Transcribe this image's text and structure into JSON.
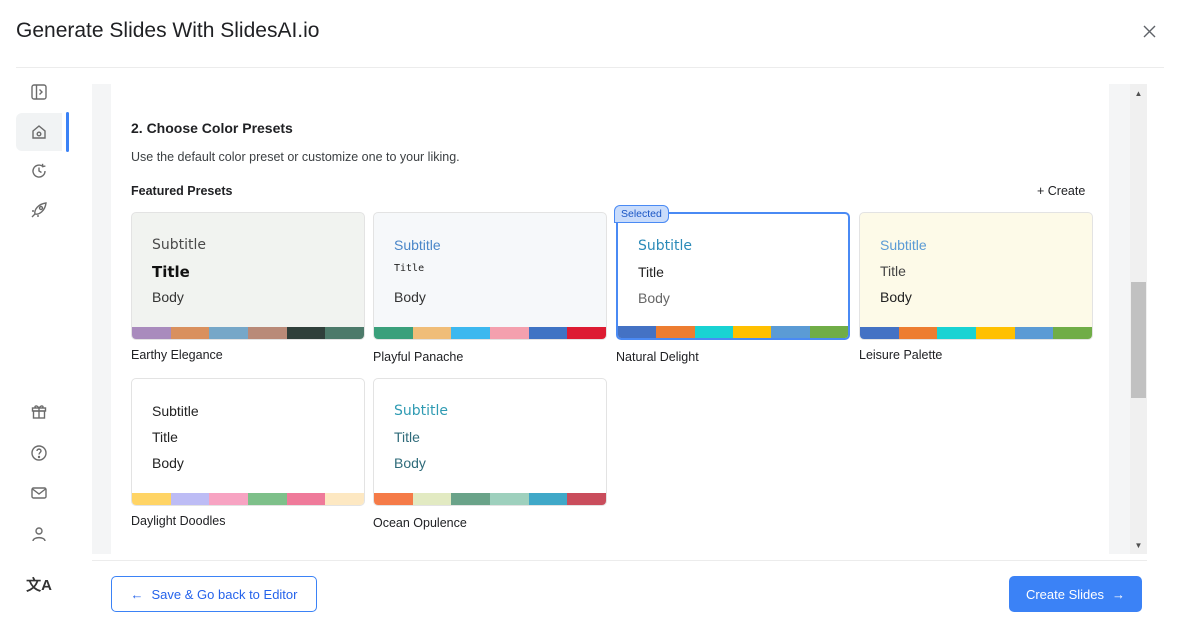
{
  "dialog": {
    "title": "Generate Slides With SlidesAI.io",
    "close_icon": "×"
  },
  "rail": {
    "top_icons": [
      "sidebar-toggle-icon",
      "home-icon",
      "history-icon",
      "rocket-icon"
    ],
    "bottom_icons": [
      "gift-icon",
      "help-icon",
      "mail-icon",
      "user-icon",
      "translate-icon"
    ],
    "translate_glyph": "文A",
    "active_color": "#3b82f6"
  },
  "section": {
    "title": "2. Choose Color Presets",
    "description": "Use the default color preset or customize one to your liking.",
    "featured_label": "Featured Presets",
    "create_label": "+ Create",
    "selected_badge": "Selected"
  },
  "presets": [
    {
      "name": "Earthy Elegance",
      "subtitle": "Subtitle",
      "title": "Title",
      "body": "Body",
      "background": "#f1f3f0",
      "sub_color": "#4a4a4a",
      "title_color": "#111111",
      "body_color": "#333333",
      "palette": [
        "#a98bbd",
        "#d9905e",
        "#76a7c8",
        "#b98a78",
        "#2f3f3a",
        "#4c7a6a"
      ]
    },
    {
      "name": "Playful Panache",
      "subtitle": "Subtitle",
      "title": "Title",
      "body": "Body",
      "background": "#f6f8fa",
      "sub_color": "#4a86c8",
      "title_color": "#222222",
      "body_color": "#333333",
      "palette": [
        "#3aa07b",
        "#f0bd78",
        "#3cb8ef",
        "#f4a0ae",
        "#3f73c4",
        "#dd1b32"
      ]
    },
    {
      "name": "Natural Delight",
      "subtitle": "Subtitle",
      "title": "Title",
      "body": "Body",
      "background": "#ffffff",
      "sub_color": "#2b8ab8",
      "title_color": "#222222",
      "body_color": "#666666",
      "palette": [
        "#4472c4",
        "#ed7d31",
        "#19d3d3",
        "#ffc000",
        "#5b9bd5",
        "#70ad47"
      ]
    },
    {
      "name": "Leisure Palette",
      "subtitle": "Subtitle",
      "title": "Title",
      "body": "Body",
      "background": "#fdfae8",
      "sub_color": "#5b9bd5",
      "title_color": "#444444",
      "body_color": "#222222",
      "palette": [
        "#4472c4",
        "#ed7d31",
        "#19d3d3",
        "#ffc000",
        "#5b9bd5",
        "#70ad47"
      ]
    },
    {
      "name": "Daylight Doodles",
      "subtitle": "Subtitle",
      "title": "Title",
      "body": "Body",
      "background": "#ffffff",
      "sub_color": "#222222",
      "title_color": "#222222",
      "body_color": "#222222",
      "palette": [
        "#ffd465",
        "#bdbcf5",
        "#f7a3c2",
        "#7ec08a",
        "#ef7a9a",
        "#fde8c2"
      ]
    },
    {
      "name": "Ocean Opulence",
      "subtitle": "Subtitle",
      "title": "Title",
      "body": "Body",
      "background": "#ffffff",
      "sub_color": "#2f9bb3",
      "title_color": "#2f6b7a",
      "body_color": "#2f6b7a",
      "palette": [
        "#f57b48",
        "#e2eac2",
        "#6aa389",
        "#9ed0bd",
        "#40a8c8",
        "#c94d5c"
      ]
    }
  ],
  "footer": {
    "back_arrow": "←",
    "back_label": "Save & Go back to Editor",
    "create_label": "Create Slides",
    "create_arrow": "→"
  }
}
